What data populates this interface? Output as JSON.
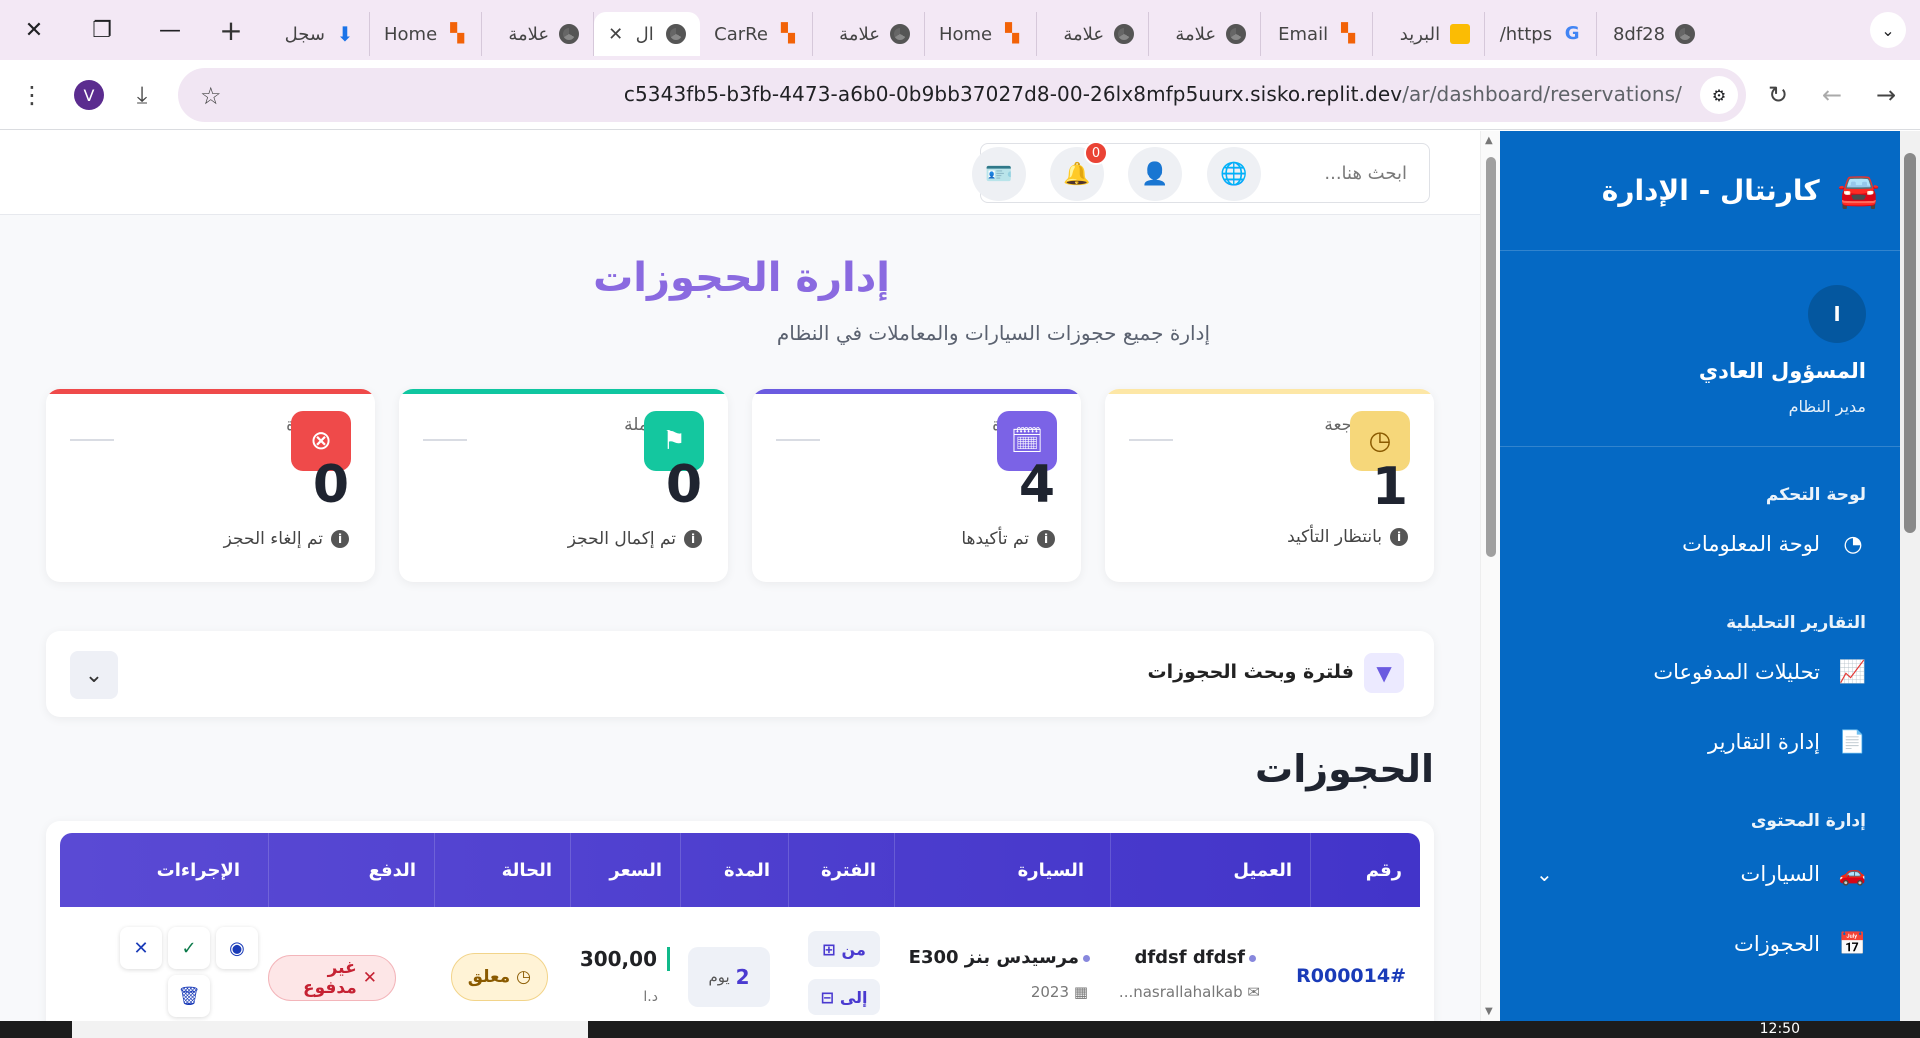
{
  "browser": {
    "tabs": [
      {
        "title": "سجل",
        "icon": "download-icon"
      },
      {
        "title": "Home",
        "icon": "replit-icon"
      },
      {
        "title": "علامة",
        "icon": "chrome-icon"
      },
      {
        "title": "ال",
        "icon": "chrome-icon",
        "active": true
      },
      {
        "title": "CarRe",
        "icon": "replit-icon"
      },
      {
        "title": "علامة",
        "icon": "chrome-icon"
      },
      {
        "title": "Home",
        "icon": "replit-icon"
      },
      {
        "title": "علامة",
        "icon": "chrome-icon"
      },
      {
        "title": "علامة",
        "icon": "chrome-icon"
      },
      {
        "title": "Email",
        "icon": "replit-icon"
      },
      {
        "title": "البريد",
        "icon": "mail-icon"
      },
      {
        "title": "/https",
        "icon": "google-icon"
      },
      {
        "title": "8df28",
        "icon": "chrome-icon"
      }
    ],
    "url_host": "c5343fb5-b3fb-4473-a6b0-0b9bb37027d8-00-26lx8mfp5uurx.sisko.replit.dev",
    "url_path": "/ar/dashboard/reservations/",
    "profile_initial": "V"
  },
  "sidebar": {
    "brand": "كارنتال - الإدارة",
    "user_initial": "ا",
    "user_name": "المسؤول العادي",
    "user_role": "مدير النظام",
    "sections": [
      {
        "title": "لوحة التحكم",
        "items": [
          {
            "label": "لوحة المعلومات",
            "icon": "dashboard-gauge-icon"
          }
        ]
      },
      {
        "title": "التقارير التحليلية",
        "items": [
          {
            "label": "تحليلات المدفوعات",
            "icon": "chart-line-icon"
          },
          {
            "label": "إدارة التقارير",
            "icon": "document-icon"
          }
        ]
      },
      {
        "title": "إدارة المحتوى",
        "items": [
          {
            "label": "السيارات",
            "icon": "car-icon"
          },
          {
            "label": "الحجوزات",
            "icon": "calendar-check-icon"
          }
        ]
      }
    ]
  },
  "topbar": {
    "search_placeholder": "ابحث هنا...",
    "notifications_count": "0"
  },
  "header": {
    "title": "إدارة الحجوزات",
    "subtitle": "إدارة جميع حجوزات السيارات والمعاملات في النظام"
  },
  "stats": [
    {
      "label": "المراجعة",
      "value": "1",
      "caption": "بانتظار التأكيد",
      "color": "#f6c343",
      "icon": "clock-icon"
    },
    {
      "label": "ة",
      "value": "4",
      "caption": "تم تأكيدها",
      "color": "#6b5be0",
      "icon": "calendar-check-icon"
    },
    {
      "label": "ملة",
      "value": "0",
      "caption": "تم إكمال الحجز",
      "color": "#10c6a0",
      "icon": "flag-checkered-icon"
    },
    {
      "label": "ة",
      "value": "0",
      "caption": "تم إلغاء الحجز",
      "color": "#ef4a4a",
      "icon": "x-circle-icon"
    }
  ],
  "filter": {
    "title": "فلترة وبحث الحجوزات"
  },
  "reservations": {
    "title": "الحجوزات",
    "columns": [
      "رقم",
      "العميل",
      "السيارة",
      "الفترة",
      "المدة",
      "السعر",
      "الحالة",
      "الدفع",
      "الإجراءات"
    ],
    "rows": [
      {
        "id": "R000014#",
        "customer_name": "dfdsf dfdsf",
        "customer_email": "nasrallahalkab...",
        "car_name": "مرسيدس بنز E300",
        "car_year": "2023",
        "from_label": "من",
        "to_label": "إلى",
        "duration_value": "2",
        "duration_unit": "يوم",
        "price": "300,00",
        "currency": "د.ا",
        "status": "معلق",
        "payment": "غير مدفوع"
      }
    ]
  },
  "taskbar": {
    "clock": "12:50"
  }
}
